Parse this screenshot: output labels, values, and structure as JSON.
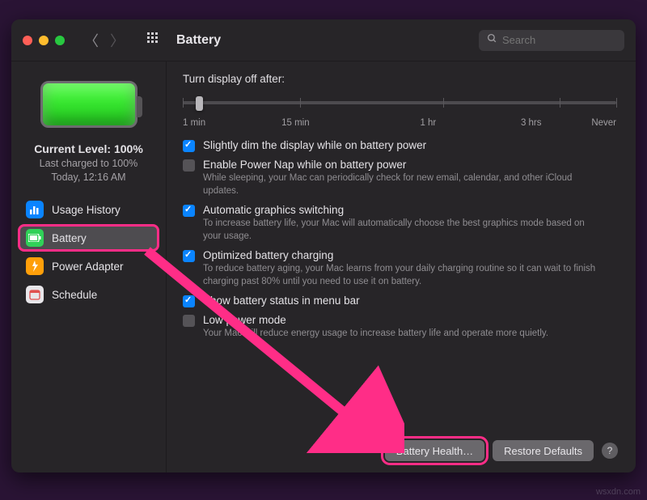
{
  "window": {
    "title": "Battery",
    "search_placeholder": "Search"
  },
  "sidebar": {
    "level_line": "Current Level: 100%",
    "charged_line": "Last charged to 100%",
    "time_line": "Today, 12:16 AM",
    "items": [
      {
        "icon": "bars-icon",
        "label": "Usage History",
        "icon_color": "blue"
      },
      {
        "icon": "battery-icon",
        "label": "Battery",
        "icon_color": "green",
        "selected": true,
        "highlight": true
      },
      {
        "icon": "plug-icon",
        "label": "Power Adapter",
        "icon_color": "orange"
      },
      {
        "icon": "calendar-icon",
        "label": "Schedule",
        "icon_color": "white"
      }
    ]
  },
  "main": {
    "display_off_label": "Turn display off after:",
    "slider_labels": [
      "1 min",
      "15 min",
      "1 hr",
      "3 hrs",
      "Never"
    ],
    "settings": [
      {
        "checked": true,
        "title": "Slightly dim the display while on battery power",
        "desc": ""
      },
      {
        "checked": false,
        "title": "Enable Power Nap while on battery power",
        "desc": "While sleeping, your Mac can periodically check for new email, calendar, and other iCloud updates."
      },
      {
        "checked": true,
        "title": "Automatic graphics switching",
        "desc": "To increase battery life, your Mac will automatically choose the best graphics mode based on your usage."
      },
      {
        "checked": true,
        "title": "Optimized battery charging",
        "desc": "To reduce battery aging, your Mac learns from your daily charging routine so it can wait to finish charging past 80% until you need to use it on battery."
      },
      {
        "checked": true,
        "title": "Show battery status in menu bar",
        "desc": ""
      },
      {
        "checked": false,
        "title": "Low power mode",
        "desc": "Your Mac will reduce energy usage to increase battery life and operate more quietly."
      }
    ],
    "battery_health_btn": "Battery Health…",
    "restore_btn": "Restore Defaults",
    "help": "?"
  },
  "watermark": "wsxdn.com"
}
